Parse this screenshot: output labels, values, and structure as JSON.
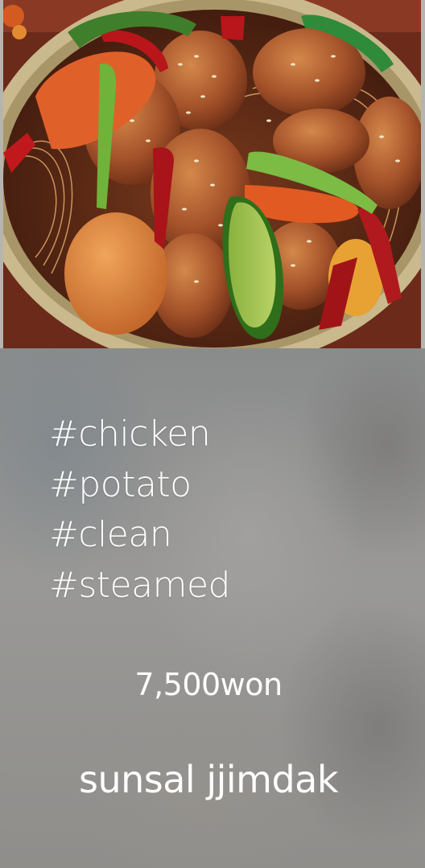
{
  "photo": {
    "icon": "braised-chicken-dish-image"
  },
  "tags": [
    "#chicken",
    "#potato",
    "#clean",
    "#steamed"
  ],
  "price": "7,500won",
  "dish_name": "sunsal jjimdak",
  "colors": {
    "text": "#ffffff",
    "panel": "#999896"
  }
}
